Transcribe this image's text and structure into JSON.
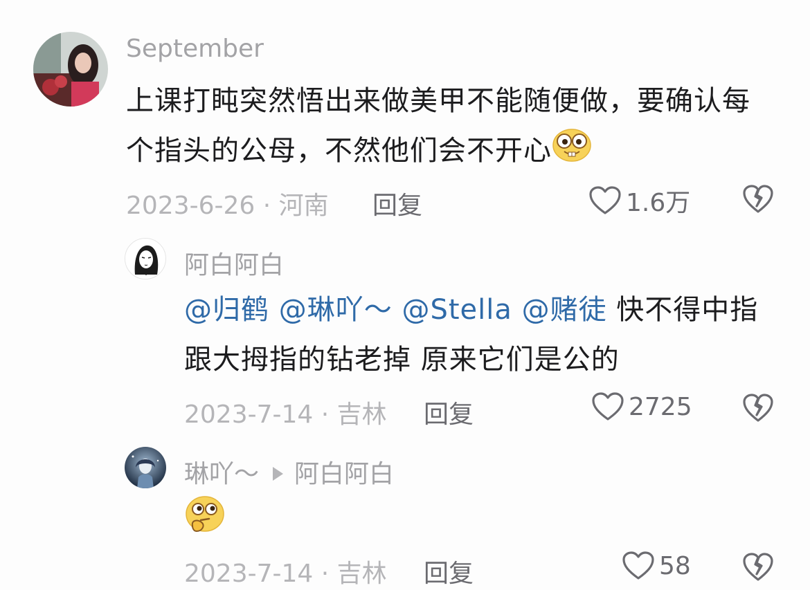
{
  "comments": [
    {
      "user": "September",
      "text": "上课打盹突然悟出来做美甲不能随便做，要确认每个指头的公母，不然他们会不开心",
      "date": "2023-6-26 · 河南",
      "reply_label": "回复",
      "likes": "1.6万",
      "emoji": "nerd-emoji"
    },
    {
      "user": "阿白阿白",
      "mentions": [
        "@归鹤",
        "@琳吖～",
        "@Stella",
        "@赌徒"
      ],
      "text": "快不得中指跟大拇指的钻老掉 原来它们是公的",
      "date": "2023-7-14 · 吉林",
      "reply_label": "回复",
      "likes": "2725"
    },
    {
      "user": "琳吖～",
      "reply_to": "阿白阿白",
      "emoji": "thinking-emoji",
      "date": "2023-7-14 · 吉林",
      "reply_label": "回复",
      "likes": "58"
    }
  ],
  "colors": {
    "mention": "#2f6aa8",
    "muted": "#b5b5b8",
    "text": "#1c1c1e"
  }
}
